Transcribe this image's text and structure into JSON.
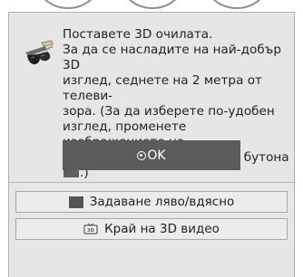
{
  "dialog": {
    "message": "Поставете 3D очилата.\nЗа да се насладите на най-добър 3D\nизглед, седнете на 2 метра от телеви-\nзора. (За да изберете по-удобен\nизглед, променете изображението на\nочилата вляво/вдясно чрез бутона",
    "message_suffix": ".)",
    "ok_label": "OK",
    "left_right_label": "Задаване ляво/вдясно",
    "end_3d_label": "Край на 3D видео"
  },
  "icons": {
    "glasses": "3d-glasses-icon",
    "ok": "ok-circle-icon",
    "swatch": "button-swatch-icon",
    "tv3d": "3d-tv-icon"
  },
  "colors": {
    "dialog_bg": "#e6e6e6",
    "ok_button_bg": "#5b5b5b",
    "swatch": "#5f5f5f",
    "text": "#222222"
  }
}
